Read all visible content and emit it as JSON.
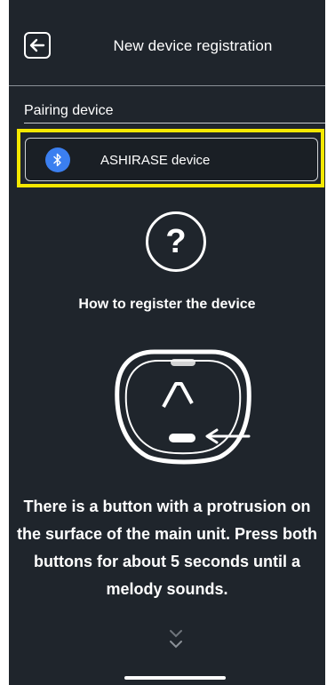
{
  "header": {
    "title": "New device registration",
    "back_icon": "arrow-left-icon"
  },
  "pairing": {
    "section_label": "Pairing device",
    "device": {
      "name": "ASHIRASE device",
      "icon": "bluetooth-icon"
    }
  },
  "help": {
    "icon_glyph": "?",
    "title": "How to register the device",
    "instructions": "There is a button with a protrusion on the surface of the main unit. Press both buttons for about 5 seconds until a melody sounds."
  },
  "colors": {
    "background": "#1f252c",
    "highlight": "#f5e800",
    "bluetooth": "#3b7ff0",
    "text": "#ffffff"
  }
}
